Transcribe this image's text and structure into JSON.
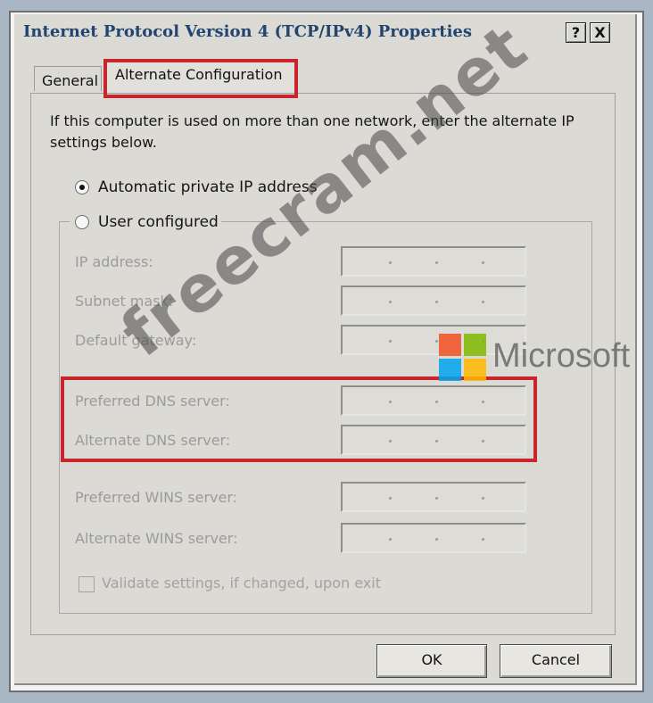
{
  "title": "Internet Protocol Version 4 (TCP/IPv4) Properties",
  "title_buttons": {
    "help": "?",
    "close": "X"
  },
  "tabs": [
    {
      "label": "General",
      "selected": false
    },
    {
      "label": "Alternate Configuration",
      "selected": true
    }
  ],
  "intro_text": "If this computer is used on more than one network, enter the alternate IP settings below.",
  "radios": [
    {
      "label": "Automatic private IP address",
      "checked": true
    },
    {
      "label": "User configured",
      "checked": false
    }
  ],
  "fields": [
    {
      "label": "IP address:",
      "value": ""
    },
    {
      "label": "Subnet mask:",
      "value": ""
    },
    {
      "label": "Default gateway:",
      "value": ""
    },
    {
      "label": "Preferred DNS server:",
      "value": ""
    },
    {
      "label": "Alternate DNS server:",
      "value": ""
    },
    {
      "label": "Preferred WINS server:",
      "value": ""
    },
    {
      "label": "Alternate WINS server:",
      "value": ""
    }
  ],
  "validate_checkbox": {
    "label": "Validate settings, if changed, upon exit",
    "checked": false
  },
  "buttons": {
    "ok": "OK",
    "cancel": "Cancel"
  },
  "watermark": "freecram.net",
  "overlay_brand": "Microsoft",
  "colors": {
    "highlight": "#c8252e",
    "title_text": "#22456f",
    "ms_red": "#f25022",
    "ms_green": "#7fba00",
    "ms_blue": "#00a4ef",
    "ms_yellow": "#ffb900"
  }
}
